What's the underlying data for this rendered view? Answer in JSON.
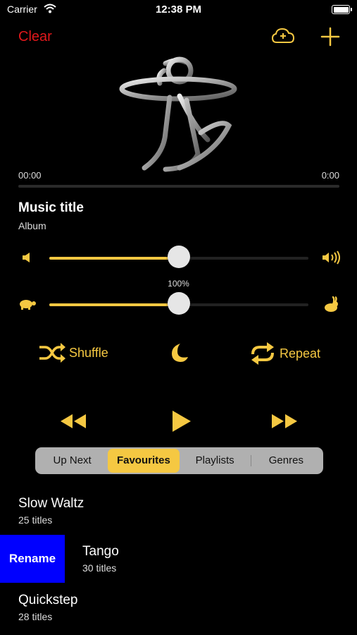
{
  "status_bar": {
    "carrier": "Carrier",
    "time": "12:38 PM"
  },
  "toolbar": {
    "clear_label": "Clear"
  },
  "player": {
    "elapsed": "00:00",
    "remaining": "0:00",
    "progress": 0,
    "title": "Music title",
    "album": "Album",
    "volume": 0.5,
    "speed_label": "100%",
    "speed": 0.5
  },
  "modes": {
    "shuffle_label": "Shuffle",
    "repeat_label": "Repeat"
  },
  "tabs": [
    {
      "label": "Up Next",
      "active": false
    },
    {
      "label": "Favourites",
      "active": true
    },
    {
      "label": "Playlists",
      "active": false
    },
    {
      "label": "Genres",
      "active": false
    }
  ],
  "list": {
    "rename_label": "Rename",
    "items": [
      {
        "title": "Slow Waltz",
        "subtitle": "25 titles"
      },
      {
        "title": "Tango",
        "subtitle": "30 titles"
      },
      {
        "title": "Quickstep",
        "subtitle": "28 titles"
      }
    ]
  },
  "colors": {
    "accent": "#f5c842",
    "clear": "#e0181b",
    "rename_bg": "#0000ff"
  }
}
